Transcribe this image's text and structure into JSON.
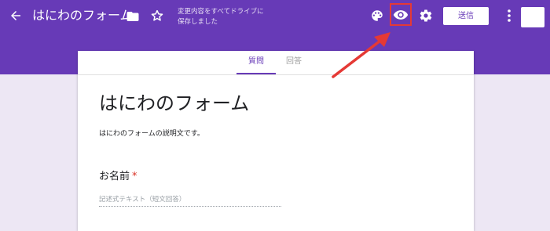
{
  "header": {
    "form_title": "はにわのフォーム",
    "save_status": "変更内容をすべてドライブに\n保存しました",
    "send_label": "送信",
    "icons": {
      "back": "arrow-back-icon",
      "folder": "folder-icon",
      "star": "star-icon",
      "palette": "palette-icon",
      "preview": "eye-icon",
      "settings": "gear-icon",
      "more": "more-vert-icon"
    }
  },
  "tabs": [
    "質問",
    "回答"
  ],
  "form": {
    "title": "はにわのフォーム",
    "description": "はにわのフォームの説明文です。",
    "question": {
      "label": "お名前",
      "required_mark": "*",
      "placeholder": "記述式テキスト（短文回答）"
    }
  },
  "colors": {
    "theme": "#673ab7",
    "background": "#ede7f4",
    "highlight": "#e53935"
  }
}
